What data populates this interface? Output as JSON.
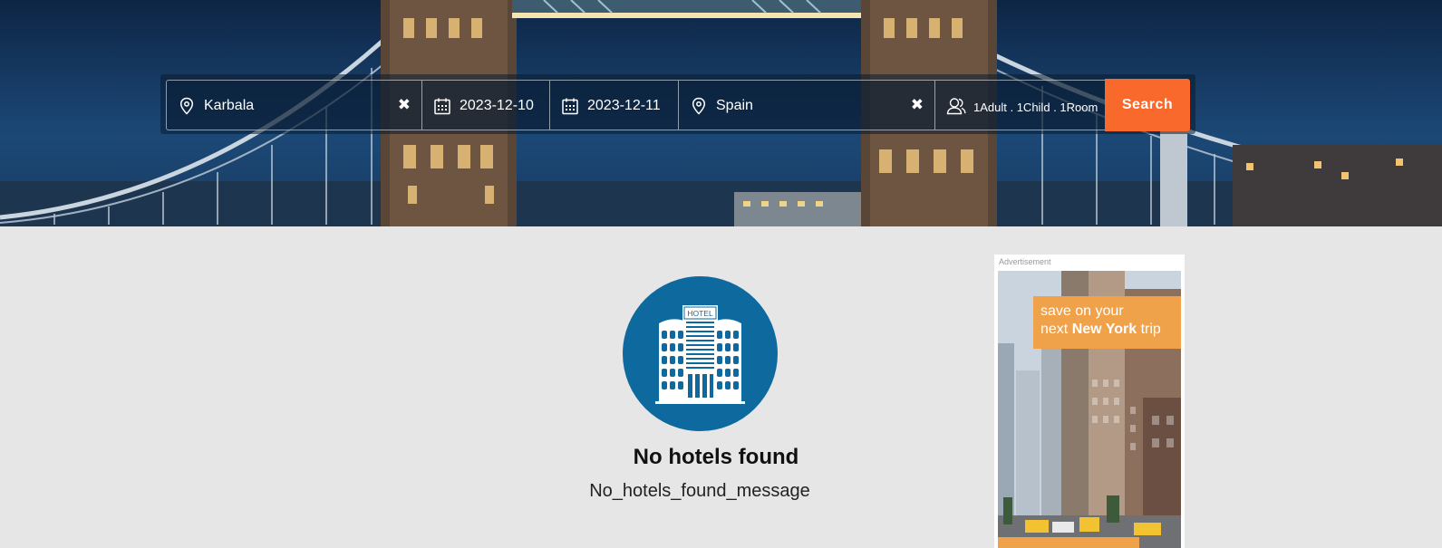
{
  "search": {
    "origin_value": "Karbala",
    "checkin_value": "2023-12-10",
    "checkout_value": "2023-12-11",
    "destination_value": "Spain",
    "guests_value": "1Adult . 1Child . 1Room",
    "clear_glyph": "✖",
    "search_label": "Search"
  },
  "empty_state": {
    "icon_text": "HOTEL",
    "title": "No hotels found",
    "message": "No_hotels_found_message"
  },
  "ad": {
    "label": "Advertisement",
    "line1": "save on your",
    "line2_prefix": "next ",
    "line2_bold": "New York",
    "line2_suffix": " trip"
  },
  "colors": {
    "accent": "#f9692c",
    "hotel_circle": "#0e6a9e",
    "ad_banner": "#f0a24a"
  },
  "icons": {
    "location": "location-pin-icon",
    "calendar": "calendar-icon",
    "guests": "user-icon",
    "clear": "close-icon",
    "hotel": "hotel-building-icon"
  }
}
